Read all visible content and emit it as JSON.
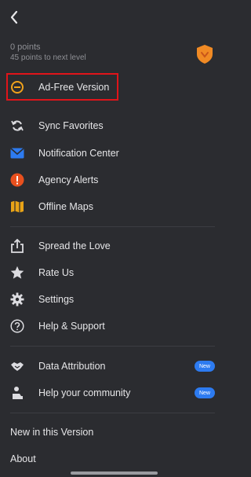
{
  "points": {
    "current": "0 points",
    "next_level": "45 points to next level"
  },
  "menu": {
    "ad_free": "Ad-Free Version",
    "group1": [
      {
        "label": "Sync Favorites",
        "icon": "sync-icon"
      },
      {
        "label": "Notification Center",
        "icon": "mail-icon"
      },
      {
        "label": "Agency Alerts",
        "icon": "alert-icon"
      },
      {
        "label": "Offline Maps",
        "icon": "map-icon"
      }
    ],
    "group2": [
      {
        "label": "Spread the Love",
        "icon": "share-icon"
      },
      {
        "label": "Rate Us",
        "icon": "star-icon"
      },
      {
        "label": "Settings",
        "icon": "gear-icon"
      },
      {
        "label": "Help & Support",
        "icon": "help-icon"
      }
    ],
    "group3": [
      {
        "label": "Data Attribution",
        "icon": "handshake-icon",
        "badge": "New"
      },
      {
        "label": "Help your community",
        "icon": "community-icon",
        "badge": "New"
      }
    ],
    "footer": [
      "New in this Version",
      "About"
    ]
  },
  "colors": {
    "background": "#2b2c30",
    "highlight": "#e0141a",
    "badge": "#2d7bf0",
    "accent_orange": "#f08a24"
  }
}
